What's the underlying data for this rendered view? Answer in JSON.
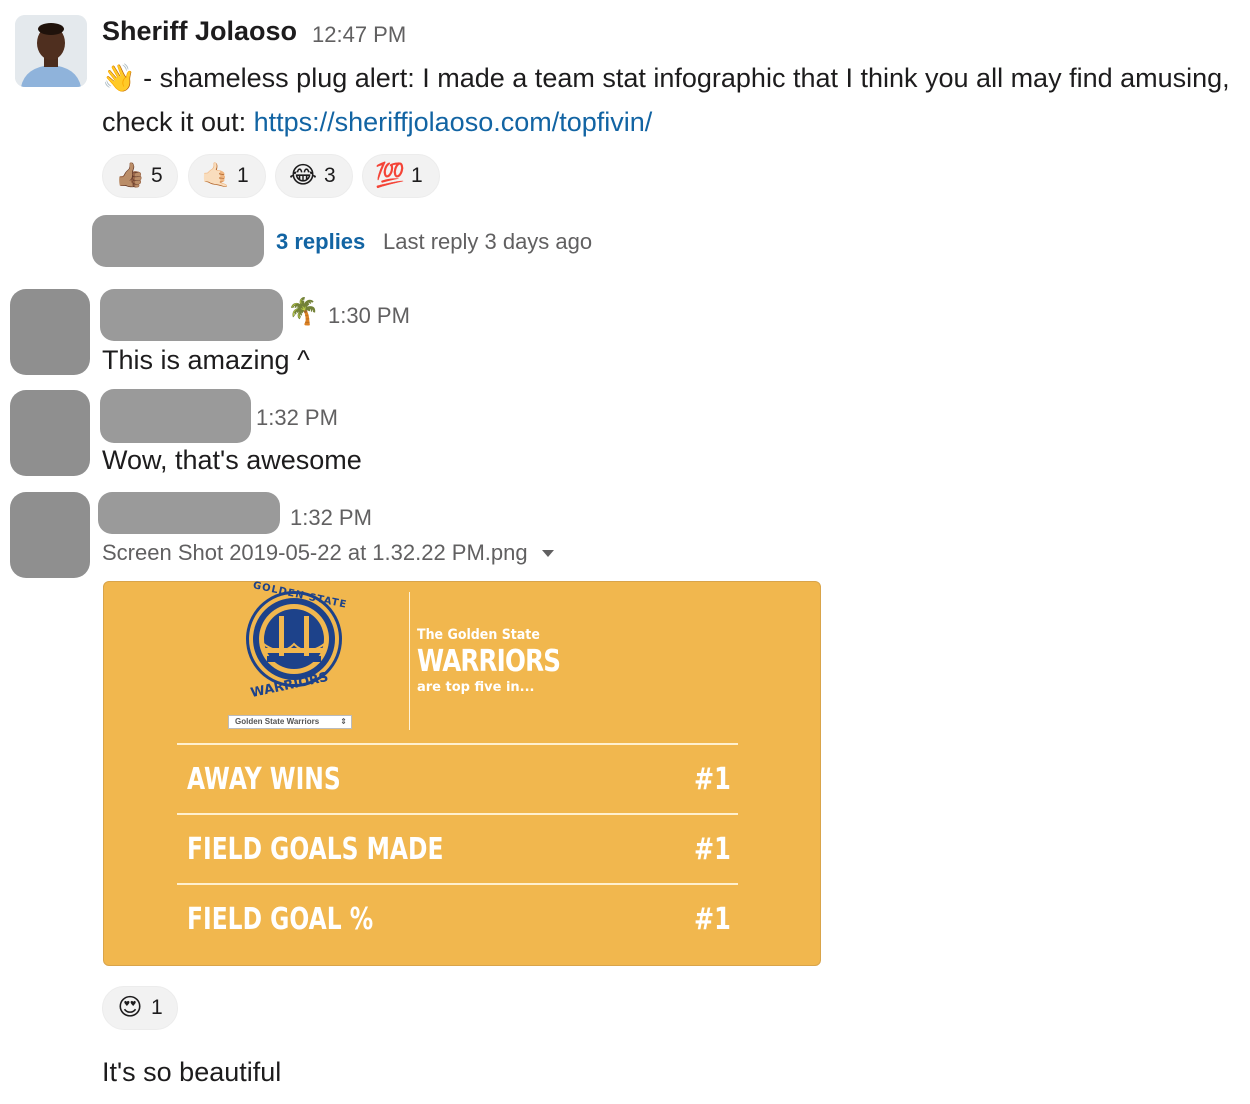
{
  "messages": {
    "first": {
      "author": "Sheriff Jolaoso",
      "time": "12:47 PM",
      "wave_icon": "👋",
      "text": " - shameless plug alert: I made a team stat infographic that I think you all may find amusing, check it out: ",
      "link": "https://sheriffjolaoso.com/topfivin/",
      "reactions": [
        {
          "icon": "thumbs-up-medium-skin-icon",
          "emoji": "👍🏽",
          "count": "5"
        },
        {
          "icon": "call-me-hand-light-skin-icon",
          "emoji": "🤙🏻",
          "count": "1"
        },
        {
          "icon": "tears-of-joy-icon",
          "emoji": "😂",
          "count": "3"
        },
        {
          "icon": "hundred-points-icon",
          "emoji": "💯",
          "count": "1"
        }
      ],
      "thread": {
        "replies": "3 replies",
        "last_reply": "Last reply 3 days ago"
      }
    },
    "second": {
      "status_emoji": "🌴",
      "time": "1:30 PM",
      "text": "This is amazing ^"
    },
    "third": {
      "time": "1:32 PM",
      "text": "Wow, that's awesome"
    },
    "fourth": {
      "time": "1:32 PM",
      "file_name": "Screen Shot 2019-05-22 at 1.32.22 PM.png",
      "reaction": {
        "icon": "heart-eyes-icon",
        "emoji": "😍",
        "count": "1"
      },
      "followup": "It's so beautiful"
    }
  },
  "infographic": {
    "logo_top_text": "GOLDEN STATE",
    "logo_bottom_text": "WARRIORS",
    "select_value": "Golden State Warriors",
    "heading_small": "The Golden State",
    "heading_big": "WARRIORS",
    "heading_sub": "are top five in...",
    "stats": [
      {
        "label": "AWAY WINS",
        "rank": "#1"
      },
      {
        "label": "FIELD GOALS MADE",
        "rank": "#1"
      },
      {
        "label": "FIELD GOAL %",
        "rank": "#1"
      }
    ],
    "colors": {
      "background": "#f1b74e",
      "logo_blue": "#1d428a"
    }
  }
}
